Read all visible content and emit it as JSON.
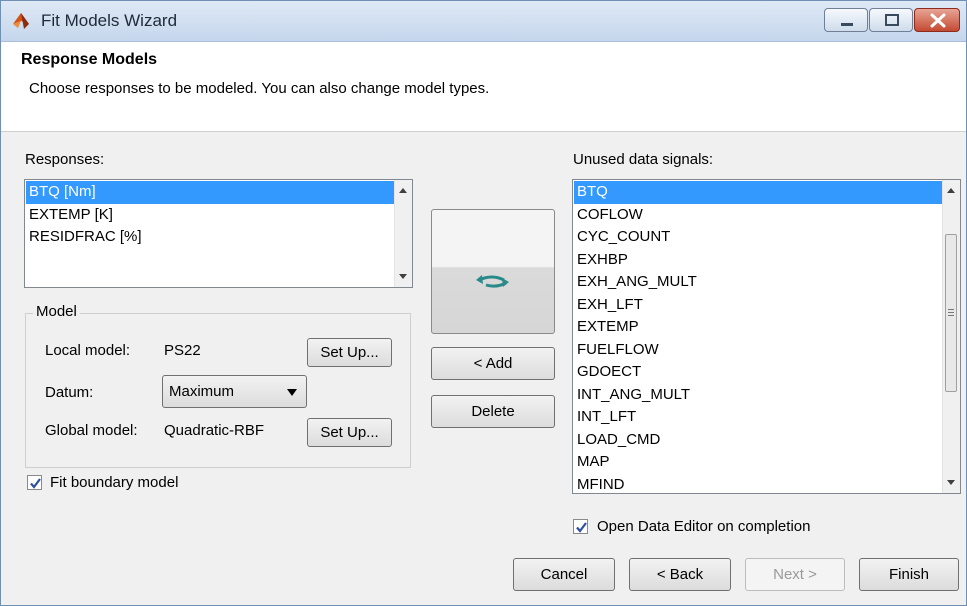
{
  "window": {
    "title": "Fit Models Wizard",
    "minimize_icon": "minimize-icon",
    "maximize_icon": "maximize-icon",
    "close_icon": "close-icon"
  },
  "header": {
    "title": "Response Models",
    "description": "Choose responses to be modeled. You can also change model types."
  },
  "responses": {
    "label": "Responses:",
    "items": [
      "BTQ [Nm]",
      "EXTEMP [K]",
      "RESIDFRAC [%]"
    ],
    "selected": "BTQ [Nm]"
  },
  "model": {
    "group_label": "Model",
    "local_label": "Local model:",
    "local_value": "PS22",
    "local_setup": "Set Up...",
    "datum_label": "Datum:",
    "datum_value": "Maximum",
    "global_label": "Global model:",
    "global_value": "Quadratic-RBF",
    "global_setup": "Set Up..."
  },
  "fit_boundary": {
    "label": "Fit boundary model",
    "checked": true
  },
  "middle": {
    "replace_icon": "replace-arrows-icon",
    "add_label": "< Add",
    "delete_label": "Delete"
  },
  "unused": {
    "label": "Unused data signals:",
    "items": [
      "BTQ",
      "COFLOW",
      "CYC_COUNT",
      "EXHBP",
      "EXH_ANG_MULT",
      "EXH_LFT",
      "EXTEMP",
      "FUELFLOW",
      "GDOECT",
      "INT_ANG_MULT",
      "INT_LFT",
      "LOAD_CMD",
      "MAP",
      "MFIND"
    ],
    "selected": "BTQ"
  },
  "open_editor": {
    "label": "Open Data Editor on completion",
    "checked": true
  },
  "footer": {
    "cancel": "Cancel",
    "back": "< Back",
    "next": "Next >",
    "finish": "Finish"
  },
  "colors": {
    "selection": "#3399ff",
    "accent_arrow": "#2a8a8a",
    "close_button": "#c44a32"
  }
}
